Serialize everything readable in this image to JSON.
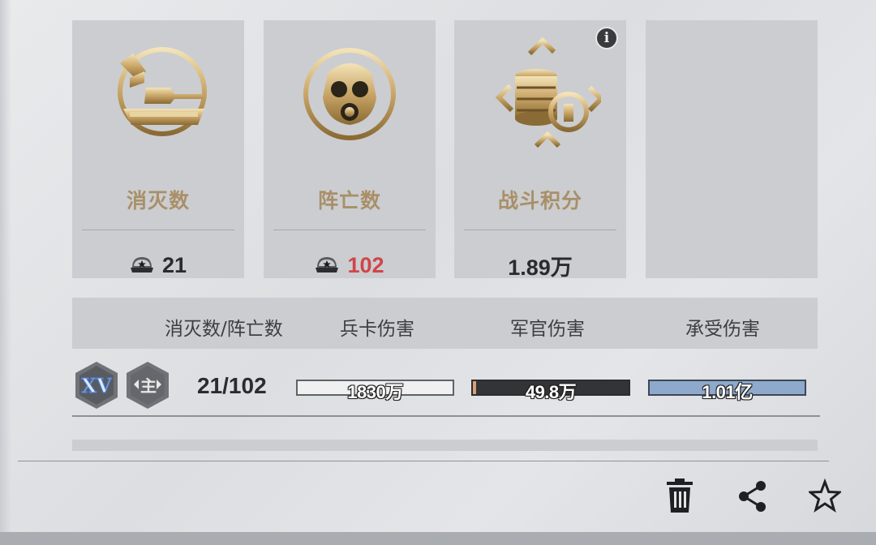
{
  "stats": [
    {
      "title": "消灭数",
      "value": "21",
      "icon": "tank-target-emblem",
      "value_color": "#2a2b2d"
    },
    {
      "title": "阵亡数",
      "value": "102",
      "icon": "gas-mask-emblem",
      "value_color": "#d0454a"
    },
    {
      "title": "战斗积分",
      "value": "1.89万",
      "icon": "coins-emblem"
    }
  ],
  "table": {
    "headers": [
      "消灭数/阵亡数",
      "兵卡伤害",
      "军官伤害",
      "承受伤害"
    ],
    "rows": [
      {
        "rank_badge": "XV",
        "class_badge": "主",
        "kd": "21/102",
        "card_damage": {
          "label": "1830万",
          "fill_fraction": 1.0,
          "color": "#f0f0f0"
        },
        "officer_damage": {
          "label": "49.8万",
          "fill_fraction": 0.02,
          "color": "#d4a07a"
        },
        "taken_damage": {
          "label": "1.01亿",
          "fill_fraction": 1.0,
          "color": "#8fa9cc"
        }
      }
    ]
  },
  "toolbar": {
    "delete": "trash-icon",
    "share": "share-icon",
    "favorite": "star-icon"
  },
  "colors": {
    "accent_gold": "#a98f68",
    "death_red": "#d0454a"
  }
}
